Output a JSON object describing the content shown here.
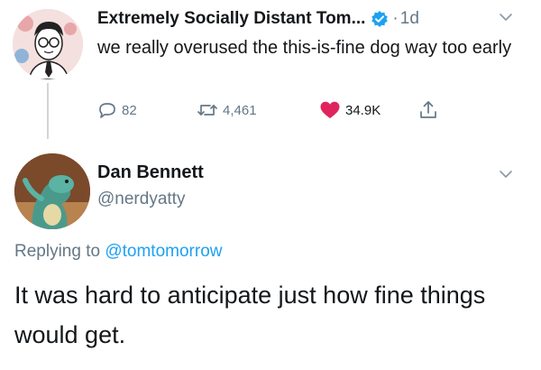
{
  "tweet1": {
    "author_name": "Extremely Socially Distant Tom...",
    "dot": "·",
    "time": "1d",
    "text": "we really overused the this-is-fine dog way too early",
    "replies": "82",
    "retweets": "4,461",
    "likes": "34.9K",
    "icons": [
      "verified-badge-icon",
      "chevron-down-icon",
      "reply-icon",
      "retweet-icon",
      "heart-icon",
      "share-icon"
    ]
  },
  "tweet2": {
    "author_name": "Dan Bennett",
    "handle": "@nerdyatty",
    "replying_prefix": "Replying to ",
    "replying_to": "@tomtomorrow",
    "text": "It was hard to anticipate just how fine things would get."
  },
  "colors": {
    "text": "#14171a",
    "muted": "#657786",
    "accent": "#1da1f2",
    "like": "#e0245e",
    "thread_line": "#cfd6db"
  }
}
